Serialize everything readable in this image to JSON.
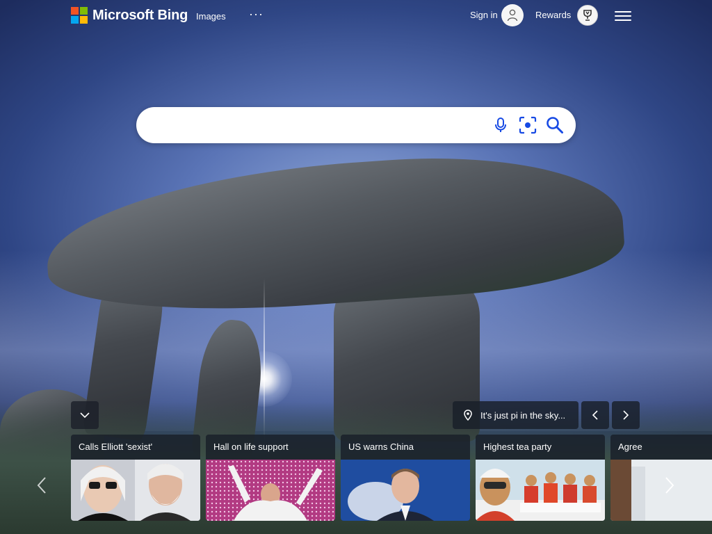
{
  "header": {
    "brand": "Microsoft Bing",
    "nav": [
      {
        "label": "Images"
      }
    ],
    "more_label": "···",
    "signin_label": "Sign in",
    "rewards_label": "Rewards"
  },
  "search": {
    "value": "",
    "placeholder": ""
  },
  "icons": {
    "logo": "microsoft-logo-icon",
    "avatar": "user-icon",
    "rewards": "trophy-icon",
    "menu": "hamburger-icon",
    "mic": "microphone-icon",
    "visual_search": "camera-search-icon",
    "search": "search-icon",
    "collapse": "chevron-down-icon",
    "location": "location-pin-icon",
    "prev": "chevron-left-icon",
    "next": "chevron-right-icon"
  },
  "image_info": {
    "caption": "It's just pi in the sky..."
  },
  "news": {
    "cards": [
      {
        "title": "Calls Elliott 'sexist'"
      },
      {
        "title": "Hall on life support"
      },
      {
        "title": "US warns China"
      },
      {
        "title": "Highest tea party"
      },
      {
        "title": "Agree"
      }
    ]
  },
  "colors": {
    "accent": "#174ae4",
    "panel": "#191e28"
  }
}
